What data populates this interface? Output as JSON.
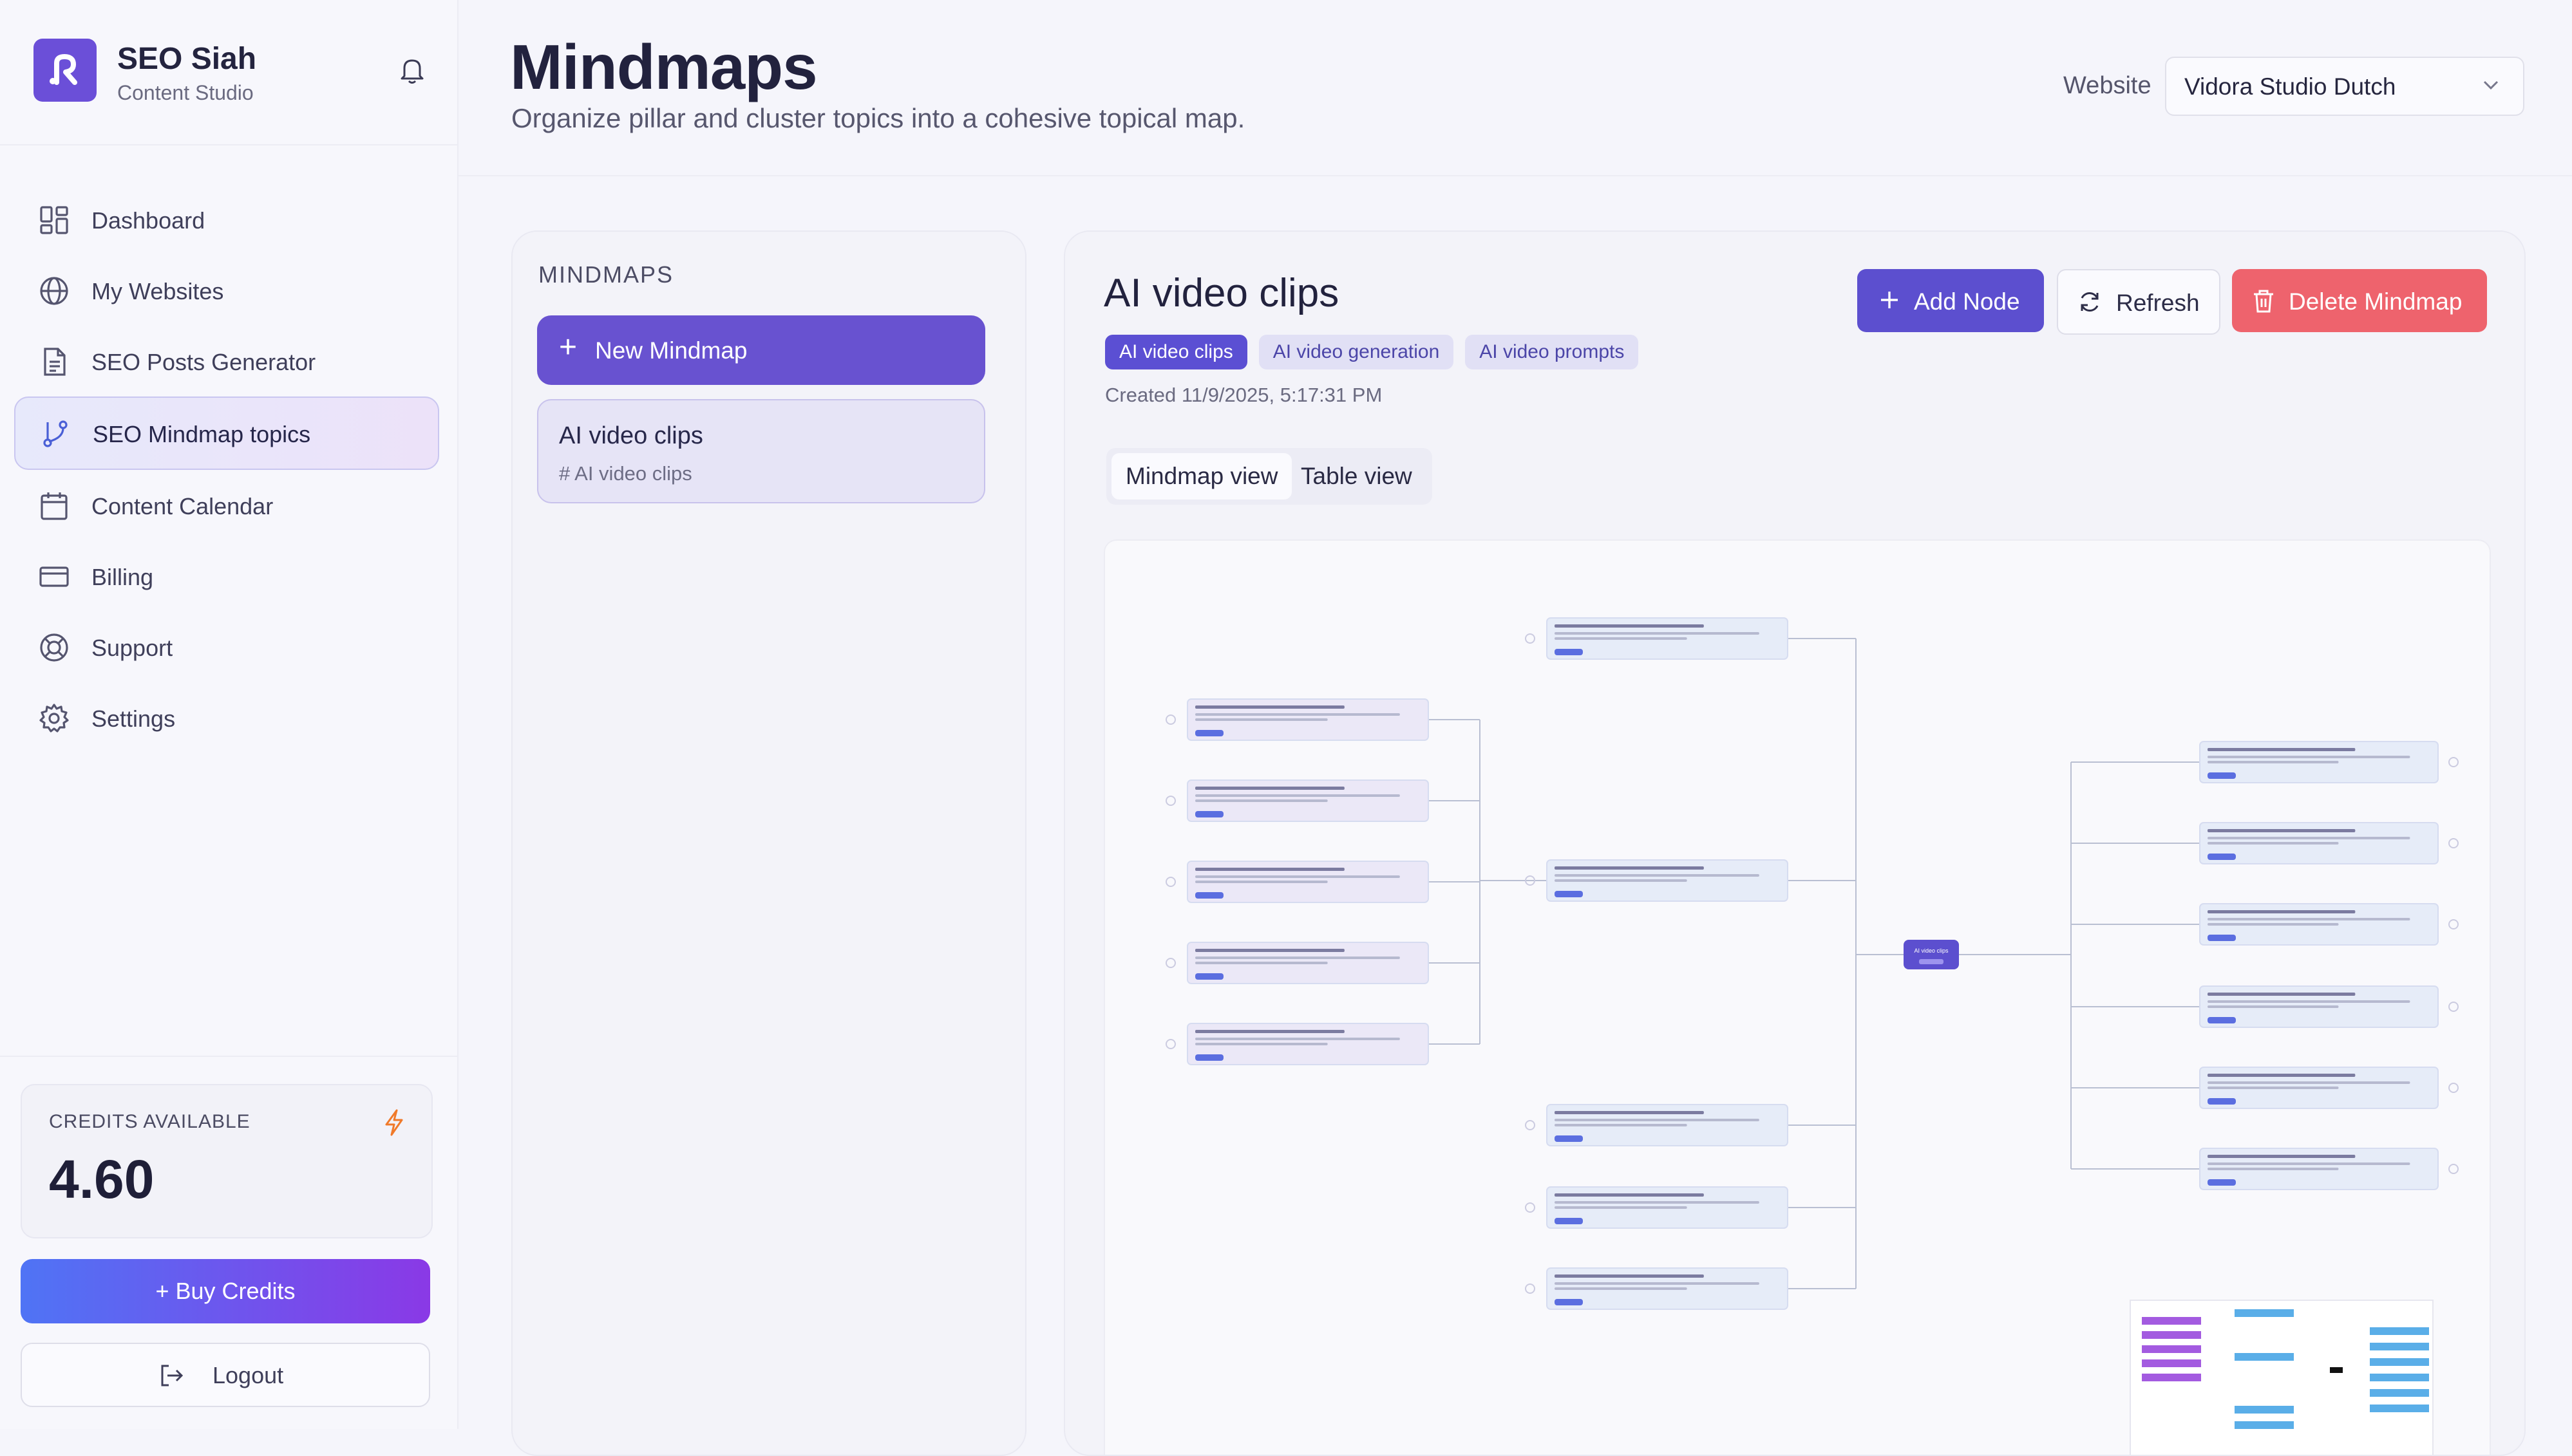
{
  "app": {
    "name": "SEO Siah",
    "subtitle": "Content Studio"
  },
  "sidebar": {
    "items": [
      {
        "label": "Dashboard",
        "icon": "dashboard-grid-icon",
        "active": false
      },
      {
        "label": "My Websites",
        "icon": "globe-icon",
        "active": false
      },
      {
        "label": "SEO Posts Generator",
        "icon": "document-icon",
        "active": false
      },
      {
        "label": "SEO Mindmap topics",
        "icon": "git-branch-icon",
        "active": true
      },
      {
        "label": "Content Calendar",
        "icon": "calendar-icon",
        "active": false
      },
      {
        "label": "Billing",
        "icon": "credit-card-icon",
        "active": false
      },
      {
        "label": "Support",
        "icon": "lifebuoy-icon",
        "active": false
      },
      {
        "label": "Settings",
        "icon": "gear-icon",
        "active": false
      }
    ],
    "credits_label": "CREDITS AVAILABLE",
    "credits_value": "4.60",
    "buy_label": "+ Buy Credits",
    "logout_label": "Logout"
  },
  "header": {
    "title": "Mindmaps",
    "subtitle": "Organize pillar and cluster topics into a cohesive topical map.",
    "website_label": "Website",
    "website_selected": "Vidora Studio Dutch"
  },
  "mindmaps_panel": {
    "title": "MINDMAPS",
    "new_label": "New Mindmap",
    "items": [
      {
        "title": "AI video clips",
        "keyword": "AI video clips"
      }
    ]
  },
  "mindmap": {
    "title": "AI video clips",
    "tags": [
      "AI video clips",
      "AI video generation",
      "AI video prompts"
    ],
    "created": "Created 11/9/2025, 5:17:31 PM",
    "add_node_label": "Add Node",
    "refresh_label": "Refresh",
    "delete_label": "Delete Mindmap",
    "view_tabs": [
      "Mindmap view",
      "Table view"
    ],
    "root_label": "AI video clips"
  },
  "colors": {
    "primary": "#5c4fcf",
    "danger": "#ee636d",
    "buy_gradient_start": "#4f74f5",
    "buy_gradient_end": "#8a39e6",
    "node_bg": "#e6ecf8",
    "node_left_bg": "#ebe8f7",
    "minimap_purple": "#a35be0",
    "minimap_blue": "#5aaee8"
  }
}
